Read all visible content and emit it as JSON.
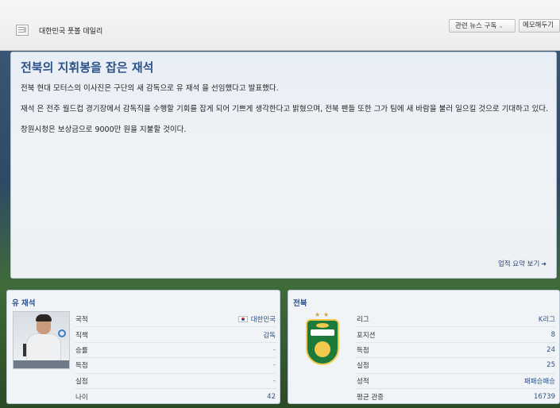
{
  "header": {
    "source": "대한민국 풋볼 데일리",
    "related_news_label": "관련 뉴스 구독",
    "memo_label": "메모해두기"
  },
  "article": {
    "title": "전북의 지휘봉을 잡은 재석",
    "paragraphs": [
      "전북 현대 모터스의 이사진은 구단의 새 감독으로 유 재석 을 선임했다고 발표했다.",
      "재석 은 전주 월드컵 경기장에서 감독직을 수행할 기회를 잡게 되어 기쁘게 생각한다고 밝혔으며, 전북 팬들 또한 그가 팀에 새 바람을 불러 일으킬 것으로 기대하고 있다.",
      "창원시청은 보상금으로 9000만 원을 지불할 것이다."
    ],
    "achievements_link": "업적 요약 보기"
  },
  "person": {
    "name": "유 재석",
    "rows": [
      {
        "label": "국적",
        "value": "대한민국"
      },
      {
        "label": "직책",
        "value": "감독"
      },
      {
        "label": "승률",
        "value": "-"
      },
      {
        "label": "득점",
        "value": "-"
      },
      {
        "label": "실점",
        "value": "-"
      },
      {
        "label": "나이",
        "value": "42"
      }
    ]
  },
  "club": {
    "name": "전북",
    "rows": [
      {
        "label": "리그",
        "value": "K리그"
      },
      {
        "label": "포지션",
        "value": "8"
      },
      {
        "label": "득점",
        "value": "24"
      },
      {
        "label": "실점",
        "value": "25"
      },
      {
        "label": "성적",
        "value": "패패승패승"
      },
      {
        "label": "평균 관중",
        "value": "16739"
      }
    ]
  },
  "icons": {
    "source": "newspaper-icon",
    "flag": "south-korea-flag-icon",
    "arrow": "arrow-right-icon",
    "dropdown": "chevron-down-icon"
  },
  "colors": {
    "title": "#2d5188",
    "link": "#2d4c7c",
    "crest_green": "#1c7a3b",
    "crest_gold": "#f2c94c"
  }
}
